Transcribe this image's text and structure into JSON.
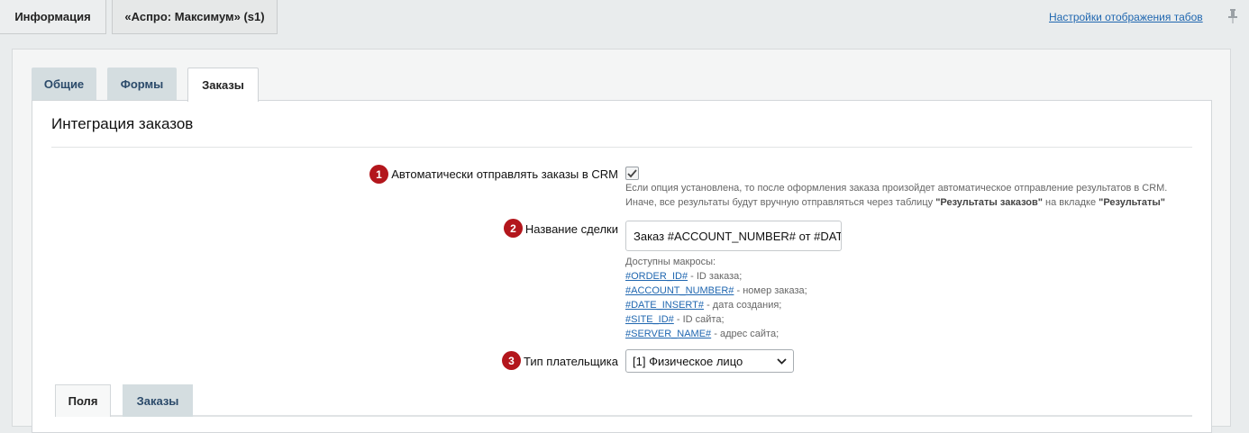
{
  "top_tabs": [
    {
      "label": "Информация"
    },
    {
      "label": "«Аспро: Максимум» (s1)"
    }
  ],
  "tab_settings_link": "Настройки отображения табов",
  "sub_tabs": [
    {
      "label": "Общие"
    },
    {
      "label": "Формы"
    },
    {
      "label": "Заказы"
    }
  ],
  "section_title": "Интеграция заказов",
  "fields": {
    "auto_send": {
      "badge": "1",
      "label": "Автоматически отправлять заказы в CRM",
      "checked": true,
      "hint_line1": "Если опция установлена, то после оформления заказа произойдет автоматическое отправление результатов в CRM.",
      "hint_line2_start": "Иначе, все результаты будут вручную отправляться через таблицу ",
      "hint_line2_bold1": "\"Результаты заказов\"",
      "hint_line2_mid": " на вкладке ",
      "hint_line2_bold2": "\"Результаты\""
    },
    "deal_name": {
      "badge": "2",
      "label": "Название сделки",
      "value": "Заказ #ACCOUNT_NUMBER# от #DATE_INSERT#",
      "macros_title": "Доступны макросы:",
      "macros": [
        {
          "code": "#ORDER_ID#",
          "desc": " - ID заказа;"
        },
        {
          "code": "#ACCOUNT_NUMBER#",
          "desc": " - номер заказа;"
        },
        {
          "code": "#DATE_INSERT#",
          "desc": " - дата создания;"
        },
        {
          "code": "#SITE_ID#",
          "desc": " - ID сайта;"
        },
        {
          "code": "#SERVER_NAME#",
          "desc": " - адрес сайта;"
        }
      ]
    },
    "payer_type": {
      "badge": "3",
      "label": "Тип плательщика",
      "selected": "[1] Физическое лицо"
    }
  },
  "inner_tabs": [
    {
      "label": "Поля"
    },
    {
      "label": "Заказы"
    }
  ],
  "colors": {
    "accent_badge": "#b3161c",
    "link": "#2067b0"
  }
}
